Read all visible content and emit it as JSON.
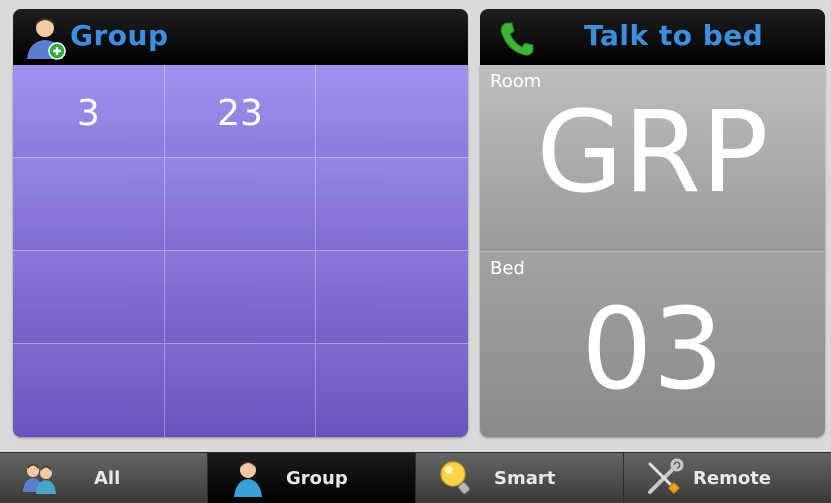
{
  "group_panel": {
    "title": "Group",
    "icon": "add-user-icon",
    "cells": [
      "3",
      "23",
      "",
      "",
      "",
      "",
      "",
      "",
      "",
      "",
      "",
      ""
    ]
  },
  "talk_panel": {
    "title": "Talk to bed",
    "icon": "phone-icon",
    "room_label": "Room",
    "room_value": "GRP",
    "bed_label": "Bed",
    "bed_value": "03"
  },
  "tabs": [
    {
      "label": "All",
      "icon": "users-icon"
    },
    {
      "label": "Group",
      "icon": "user-icon",
      "active": true
    },
    {
      "label": "Smart",
      "icon": "lightbulb-icon"
    },
    {
      "label": "Remote",
      "icon": "tools-icon"
    }
  ],
  "colors": {
    "title_blue": "#3c8fe0",
    "grid_top": "#9c8cee",
    "grid_bottom": "#6d55c1"
  }
}
